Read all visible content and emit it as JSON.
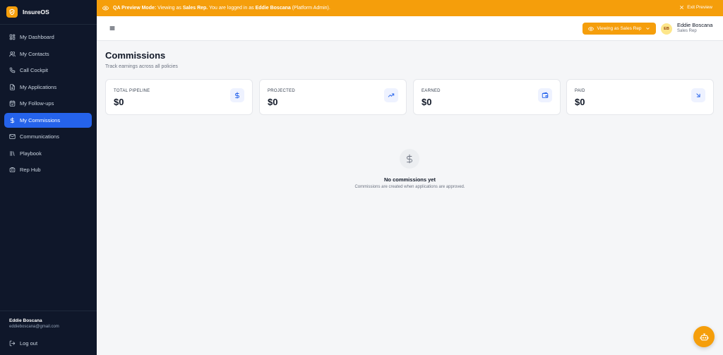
{
  "app": {
    "name": "InsureOS"
  },
  "sidebar": {
    "items": [
      {
        "label": "My Dashboard",
        "icon": "dashboard-icon"
      },
      {
        "label": "My Contacts",
        "icon": "users-icon"
      },
      {
        "label": "Call Cockpit",
        "icon": "phone-icon"
      },
      {
        "label": "My Applications",
        "icon": "document-icon"
      },
      {
        "label": "My Follow-ups",
        "icon": "calendar-icon"
      },
      {
        "label": "My Commissions",
        "icon": "dollar-icon",
        "active": true
      },
      {
        "label": "Communications",
        "icon": "mail-icon"
      },
      {
        "label": "Playbook",
        "icon": "library-icon"
      },
      {
        "label": "Rep Hub",
        "icon": "building-icon"
      }
    ],
    "user": {
      "name": "Eddie Boscana",
      "email": "eddieboscana@gmail.com"
    },
    "logout_label": "Log out"
  },
  "banner": {
    "mode_label": "QA Preview Mode:",
    "viewing_as_text": " Viewing as ",
    "role": "Sales Rep.",
    "logged_in_text": " You are logged in as ",
    "user": "Eddie Boscana",
    "admin_text": " (Platform Admin).",
    "exit_label": "Exit Preview"
  },
  "header": {
    "viewing_button_label": "Viewing as Sales Rep",
    "avatar_initials": "EB",
    "user_name": "Eddie Boscana",
    "user_role": "Sales Rep"
  },
  "page": {
    "title": "Commissions",
    "subtitle": "Track earnings across all policies"
  },
  "cards": [
    {
      "label": "TOTAL PIPELINE",
      "value": "$0",
      "icon": "dollar-icon"
    },
    {
      "label": "PROJECTED",
      "value": "$0",
      "icon": "trending-up-icon"
    },
    {
      "label": "EARNED",
      "value": "$0",
      "icon": "wallet-icon"
    },
    {
      "label": "PAID",
      "value": "$0",
      "icon": "arrow-down-right-icon"
    }
  ],
  "empty_state": {
    "title": "No commissions yet",
    "subtitle": "Commissions are created when applications are approved."
  },
  "colors": {
    "accent": "#f59e0b",
    "active_nav": "#2563eb",
    "sidebar_bg": "#0f172a",
    "icon_blue": "#2563eb"
  }
}
